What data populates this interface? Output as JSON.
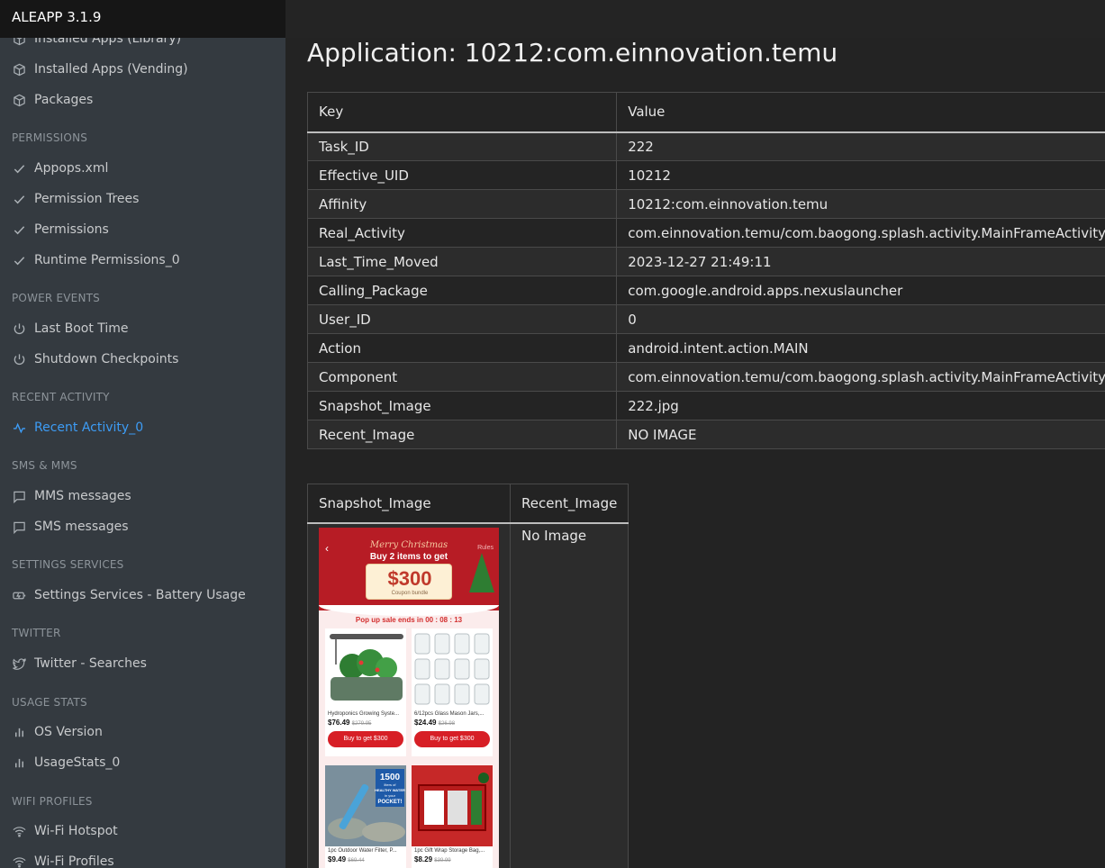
{
  "app": {
    "title": "ALEAPP 3.1.9"
  },
  "sidebar": {
    "items": [
      {
        "label": "Installed Apps (Library)",
        "icon": "package-icon"
      },
      {
        "label": "Installed Apps (Vending)",
        "icon": "package-icon"
      },
      {
        "label": "Packages",
        "icon": "package-icon"
      },
      {
        "header": "PERMISSIONS"
      },
      {
        "label": "Appops.xml",
        "icon": "check-icon"
      },
      {
        "label": "Permission Trees",
        "icon": "check-icon"
      },
      {
        "label": "Permissions",
        "icon": "check-icon"
      },
      {
        "label": "Runtime Permissions_0",
        "icon": "check-icon"
      },
      {
        "header": "POWER EVENTS"
      },
      {
        "label": "Last Boot Time",
        "icon": "power-icon"
      },
      {
        "label": "Shutdown Checkpoints",
        "icon": "power-icon"
      },
      {
        "header": "RECENT ACTIVITY"
      },
      {
        "label": "Recent Activity_0",
        "icon": "activity-icon",
        "active": true
      },
      {
        "header": "SMS & MMS"
      },
      {
        "label": "MMS messages",
        "icon": "message-icon"
      },
      {
        "label": "SMS messages",
        "icon": "message-icon"
      },
      {
        "header": "SETTINGS SERVICES"
      },
      {
        "label": "Settings Services - Battery Usage",
        "icon": "battery-icon"
      },
      {
        "header": "TWITTER"
      },
      {
        "label": "Twitter - Searches",
        "icon": "twitter-icon"
      },
      {
        "header": "USAGE STATS"
      },
      {
        "label": "OS Version",
        "icon": "bar-chart-icon"
      },
      {
        "label": "UsageStats_0",
        "icon": "bar-chart-icon"
      },
      {
        "header": "WIFI PROFILES"
      },
      {
        "label": "Wi-Fi Hotspot",
        "icon": "wifi-icon"
      },
      {
        "label": "Wi-Fi Profiles",
        "icon": "wifi-icon"
      }
    ]
  },
  "main": {
    "title": "Application: 10212:com.einnovation.temu",
    "table": {
      "headers": [
        "Key",
        "Value"
      ],
      "rows": [
        [
          "Task_ID",
          "222"
        ],
        [
          "Effective_UID",
          "10212"
        ],
        [
          "Affinity",
          "10212:com.einnovation.temu"
        ],
        [
          "Real_Activity",
          "com.einnovation.temu/com.baogong.splash.activity.MainFrameActivity"
        ],
        [
          "Last_Time_Moved",
          "2023-12-27 21:49:11"
        ],
        [
          "Calling_Package",
          "com.google.android.apps.nexuslauncher"
        ],
        [
          "User_ID",
          "0"
        ],
        [
          "Action",
          "android.intent.action.MAIN"
        ],
        [
          "Component",
          "com.einnovation.temu/com.baogong.splash.activity.MainFrameActivity"
        ],
        [
          "Snapshot_Image",
          "222.jpg"
        ],
        [
          "Recent_Image",
          "NO IMAGE"
        ]
      ]
    },
    "images_table": {
      "headers": [
        "Snapshot_Image",
        "Recent_Image"
      ],
      "recent_value": "No Image"
    },
    "snapshot": {
      "banner_title": "Merry Christmas",
      "rules": "Rules",
      "promo": "Buy 2 items to get",
      "amount": "$300",
      "coupon_label": "Coupon bundle",
      "popup": "Pop up sale ends in  00 : 08 : 13",
      "products": [
        {
          "name": "Hydroponics Growing Syste...",
          "price": "$76.49",
          "old": "$279.95",
          "button": "Buy to get $300"
        },
        {
          "name": "6/12pcs Glass Mason Jars,...",
          "price": "$24.49",
          "old": "$26.98",
          "button": "Buy to get $300"
        },
        {
          "name": "1pc Outdoor Water Filter, P...",
          "price": "$9.49",
          "old": "$69.44",
          "badge": [
            "1500",
            "liters of",
            "HEALTHY WATER",
            "in your",
            "POCKET!"
          ]
        },
        {
          "name": "1pc Gift Wrap Storage Bag,...",
          "price": "$8.29",
          "old": "$39.99"
        }
      ]
    }
  }
}
